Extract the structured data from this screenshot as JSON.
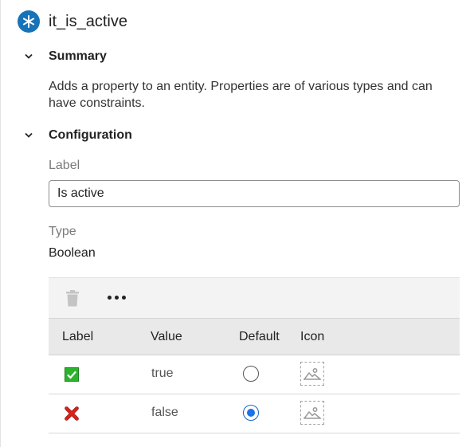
{
  "header": {
    "title": "it_is_active",
    "icon": "asterisk-icon",
    "icon_color": "#1773b8"
  },
  "summary": {
    "title": "Summary",
    "text": "Adds a property to an entity. Properties are of various types and can have constraints."
  },
  "configuration": {
    "title": "Configuration",
    "label_caption": "Label",
    "label_value": "Is active",
    "type_caption": "Type",
    "type_value": "Boolean"
  },
  "grid": {
    "toolbar": [
      "trash-icon",
      "more-icon"
    ],
    "columns": [
      "Label",
      "Value",
      "Default",
      "Icon"
    ],
    "rows": [
      {
        "label_icon": "green-check-icon",
        "value": "true",
        "default": false,
        "icon": "image-placeholder-icon"
      },
      {
        "label_icon": "red-x-icon",
        "value": "false",
        "default": true,
        "icon": "image-placeholder-icon"
      }
    ]
  },
  "colors": {
    "accent": "#1a73e8",
    "check_green": "#2bb42b",
    "x_red": "#e0201b"
  }
}
